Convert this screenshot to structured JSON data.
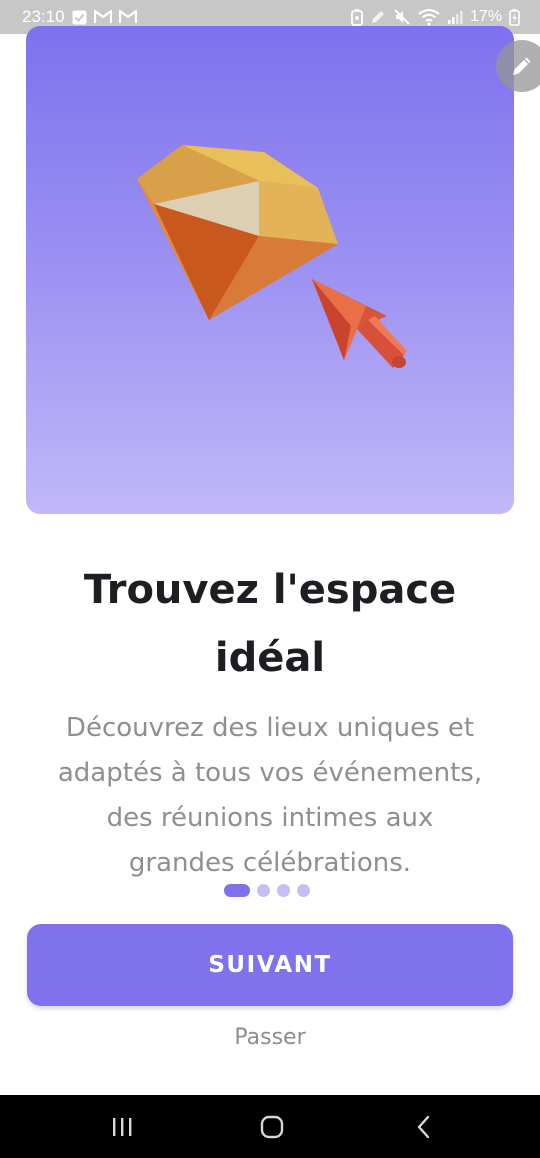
{
  "status_bar": {
    "time": "23:10",
    "battery": "17%",
    "icons": [
      "check-box-icon",
      "gmail-icon",
      "gmail-icon",
      "battery-saver-icon",
      "edit-pencil-icon",
      "mute-icon",
      "wifi-icon",
      "signal-icon",
      "battery-charging-icon"
    ]
  },
  "hero": {
    "illustration": "diamond-and-cursor-icon",
    "background_top": "#7f71ee",
    "background_bottom": "#c1b8f8"
  },
  "onboarding": {
    "title_line1": "Trouvez l'espace",
    "title_line2": "idéal",
    "description_line1": "Découvrez des lieux uniques et",
    "description_line2": "adaptés à tous vos événements,",
    "description_line3": "des réunions intimes aux",
    "description_line4": "grandes célébrations.",
    "page_count": 4,
    "current_page": 1
  },
  "actions": {
    "next_label": "SUIVANT",
    "skip_label": "Passer"
  },
  "colors": {
    "accent": "#7f72ec",
    "dot_inactive": "#c5c0f3",
    "text_primary": "#1d1d22",
    "text_secondary": "#8f8f93"
  }
}
